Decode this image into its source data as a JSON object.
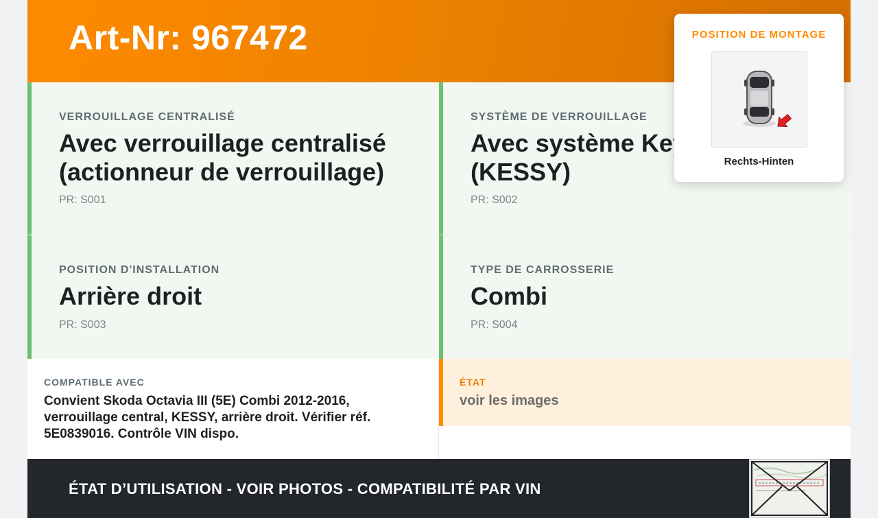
{
  "header": {
    "title": "Art-Nr: 967472"
  },
  "fields": [
    {
      "label": "VERROUILLAGE CENTRALISÉ",
      "value_line1": "Avec verrouillage centralisé",
      "value_line2": "(actionneur de verrouillage)",
      "pr": "PR: S001"
    },
    {
      "label": "SYSTÈME DE VERROUILLAGE",
      "value_line1": "Avec système Keyless Entry",
      "value_line2": "(KESSY)",
      "pr": "PR: S002"
    },
    {
      "label": "POSITION D'INSTALLATION",
      "value_line1": "Arrière droit",
      "pr": "PR: S003"
    },
    {
      "label": "TYPE DE CARROSSERIE",
      "value_line1": "Combi",
      "pr": "PR: S004"
    }
  ],
  "compatible": {
    "label": "COMPATIBLE AVEC",
    "text": "Convient Skoda Octavia III (5E) Combi 2012-2016, verrouillage central, KESSY, arrière droit. Vérifier réf. 5E0839016. Contrôle VIN dispo."
  },
  "etat": {
    "label": "ÉTAT",
    "text": "voir les images"
  },
  "footer": {
    "text": "ÉTAT D’UTILISATION - VOIR PHOTOS - COMPATIBILITÉ PAR VIN"
  },
  "popup": {
    "title": "POSITION DE MONTAGE",
    "caption": "Rechts-Hinten"
  },
  "colors": {
    "accent": "#ff8a00",
    "green_border": "#6cc070",
    "cell_bg": "#f2f8f1",
    "dark": "#23262b"
  }
}
